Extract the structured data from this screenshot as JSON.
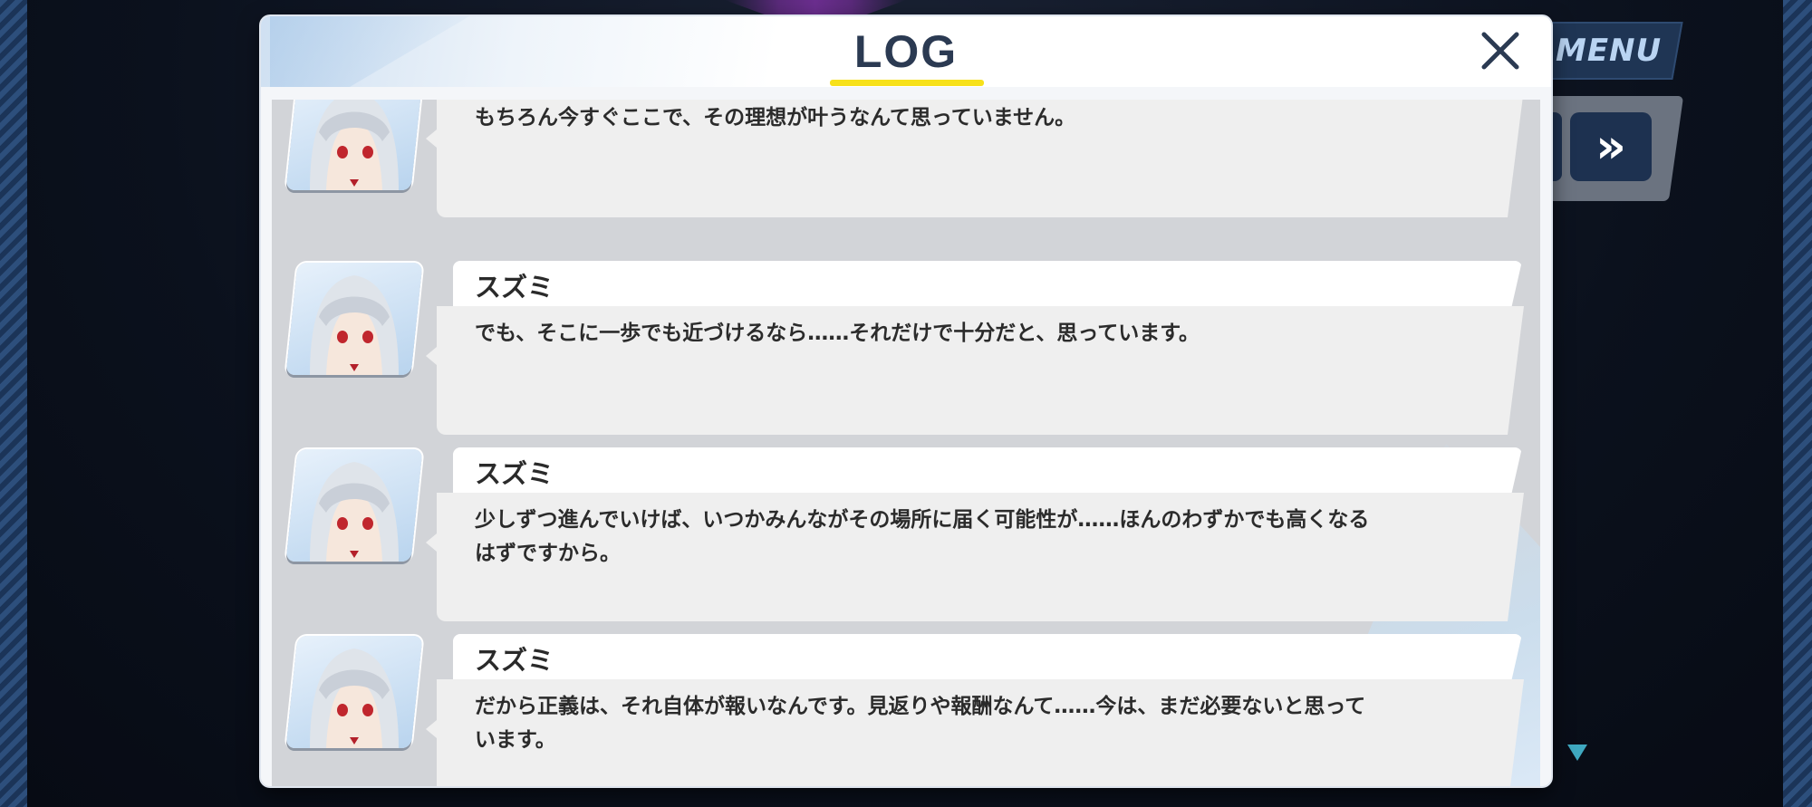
{
  "hud": {
    "menu_label": "MENU",
    "fast_forward_icon": "»"
  },
  "log": {
    "title": "LOG",
    "close_icon": "close-icon",
    "entries": [
      {
        "speaker": "",
        "text": "もちろん今すぐここで、その理想が叶うなんて思っていません。"
      },
      {
        "speaker": "スズミ",
        "text": "でも、そこに一歩でも近づけるなら……それだけで十分だと、思っています。"
      },
      {
        "speaker": "スズミ",
        "text": "少しずつ進んでいけば、いつかみんながその場所に届く可能性が……ほんのわずかでも高くなるはずですから。"
      },
      {
        "speaker": "スズミ",
        "text": "だから正義は、それ自体が報いなんです。見返りや報酬なんて……今は、まだ必要ないと思っています。"
      }
    ]
  },
  "colors": {
    "accent_underline": "#f7e11a",
    "title_text": "#2b3a52",
    "menu_bg": "#1f3554"
  }
}
